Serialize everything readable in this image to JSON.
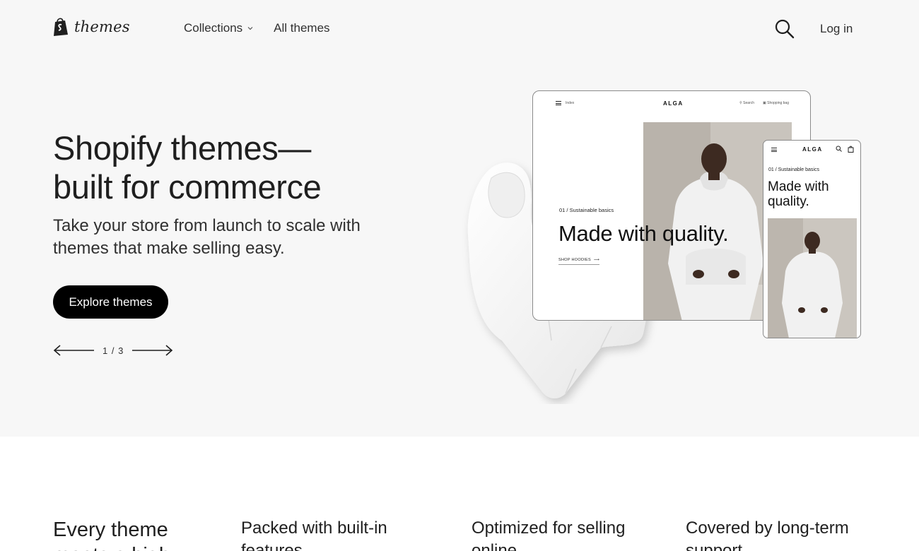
{
  "header": {
    "logo_text": "themes",
    "nav": [
      {
        "label": "Collections",
        "has_dropdown": true
      },
      {
        "label": "All themes",
        "has_dropdown": false
      }
    ],
    "search_icon": "search-icon",
    "login_label": "Log in"
  },
  "hero": {
    "title_line1": "Shopify themes—",
    "title_line2": "built for commerce",
    "subtitle": "Take your store from launch to scale with themes that make selling easy.",
    "cta_label": "Explore themes",
    "pager": "1 / 3"
  },
  "mockup_desktop": {
    "menu_label": "Index",
    "brand": "ALGA",
    "search_label": "Search",
    "bag_label": "Shopping bag",
    "eyebrow": "01 / Sustainable basics",
    "headline": "Made with quality.",
    "link_label": "SHOP HOODIES"
  },
  "mockup_mobile": {
    "brand": "ALGA",
    "eyebrow": "01 / Sustainable basics",
    "headline": "Made with quality."
  },
  "features": {
    "lead": "Every theme meets a high",
    "items": [
      "Packed with built-in features",
      "Optimized for selling online",
      "Covered by long-term support"
    ]
  },
  "colors": {
    "hero_bg": "#f7f7f7",
    "cta_bg": "#000000",
    "text": "#1f1f1f"
  }
}
